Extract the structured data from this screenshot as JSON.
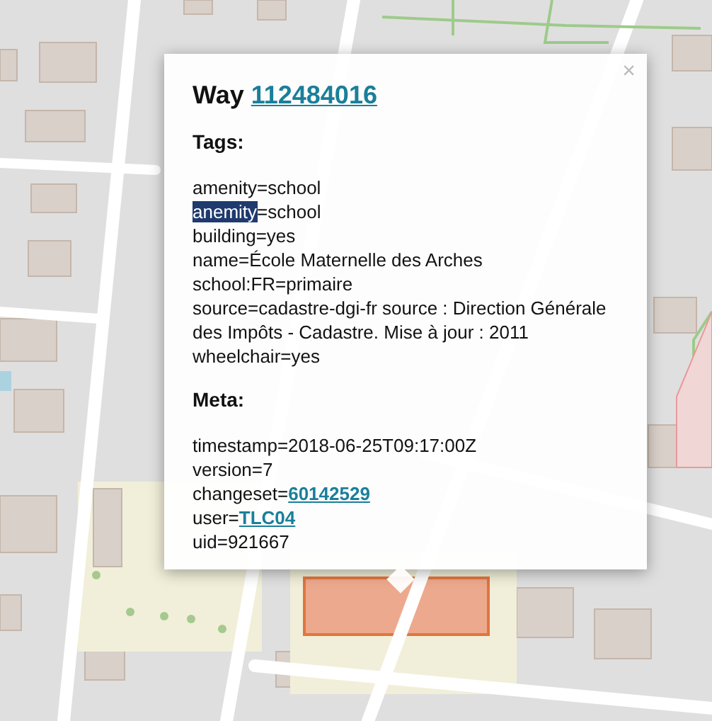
{
  "popup": {
    "close": "×",
    "title": "Way",
    "title_link": "112484016",
    "tags_heading": "Tags:",
    "tags": [
      {
        "text": "amenity=school"
      },
      {
        "highlighted_text": "anemity",
        "text": "=school"
      },
      {
        "text": "building=yes"
      },
      {
        "text": "name=École Maternelle des Arches"
      },
      {
        "text": "school:FR=primaire"
      },
      {
        "text": "source=cadastre-dgi-fr source : Direction Générale des Impôts - Cadastre. Mise à jour : 2011"
      },
      {
        "text": "wheelchair=yes"
      }
    ],
    "meta_heading": "Meta:",
    "meta": [
      {
        "text": "timestamp=2018-06-25T09:17:00Z"
      },
      {
        "text": "version=7"
      },
      {
        "text": "changeset=",
        "link": "60142529"
      },
      {
        "text": "user=",
        "link": "TLC04"
      },
      {
        "text": "uid=921667"
      }
    ]
  }
}
